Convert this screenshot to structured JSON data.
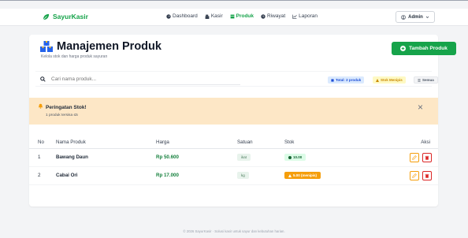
{
  "brand": {
    "name": "SayurKasir"
  },
  "nav": {
    "items": [
      {
        "label": "Dashboard",
        "icon": "speedometer-icon",
        "active": false
      },
      {
        "label": "Kasir",
        "icon": "cash-register-icon",
        "active": false
      },
      {
        "label": "Produk",
        "icon": "box-icon",
        "active": true
      },
      {
        "label": "Riwayat",
        "icon": "clock-icon",
        "active": false
      },
      {
        "label": "Laporan",
        "icon": "chart-icon",
        "active": false
      }
    ],
    "user_label": "Admin"
  },
  "page": {
    "title": "Manajemen Produk",
    "subtitle": "Kelola stok dan harga produk sayuran",
    "add_button": "Tambah Produk"
  },
  "search": {
    "placeholder": "Cari nama produk...",
    "chip_total": "Total: 2 produk",
    "chip_low": "Stok Menipis",
    "chip_reset": "Semua"
  },
  "alert": {
    "title": "Peringatan Stok!",
    "text": "1 produk tersisa ≤5"
  },
  "table": {
    "headers": [
      "No",
      "Nama Produk",
      "Harga",
      "Satuan",
      "Stok",
      "Aksi"
    ],
    "rows": [
      {
        "no": "1",
        "name": "Bawang Daun",
        "price": "Rp 50.600",
        "unit": "ikat",
        "stock": "10.00",
        "stock_status": "ok"
      },
      {
        "no": "2",
        "name": "Cabai Ori",
        "price": "Rp 17.000",
        "unit": "kg",
        "stock": "5.00 (menipis)",
        "stock_status": "low"
      }
    ]
  },
  "footer": "© 2026 SayurKasir · Solusi kasir untuk sayur dan kebutuhan harian.",
  "colors": {
    "primary": "#16a34a",
    "warning": "#f59e0b",
    "danger": "#dc2626",
    "alert_bg": "#fde7c6"
  }
}
